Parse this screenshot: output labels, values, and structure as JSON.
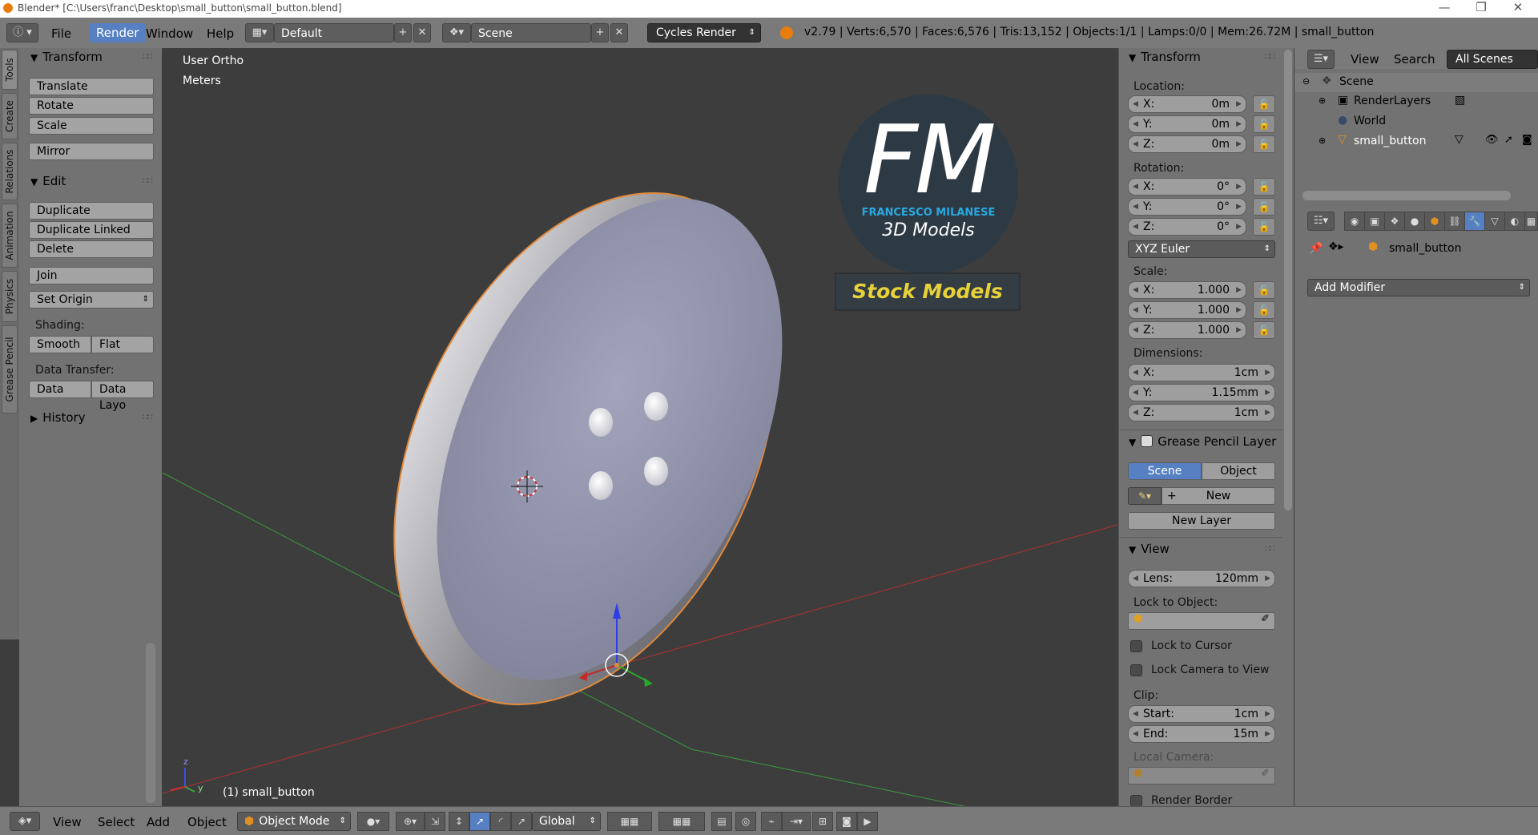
{
  "window": {
    "title": "Blender* [C:\\Users\\franc\\Desktop\\small_button\\small_button.blend]",
    "minimize": "—",
    "restore": "❐",
    "close": "✕"
  },
  "topbar": {
    "menus": [
      "File",
      "Render",
      "Window",
      "Help"
    ],
    "layout": "Default",
    "scene": "Scene",
    "engine": "Cycles Render",
    "stats": "v2.79 | Verts:6,570 | Faces:6,576 | Tris:13,152 | Objects:1/1 | Lamps:0/0 | Mem:26.72M | small_button"
  },
  "tabs": [
    "Tools",
    "Create",
    "Relations",
    "Animation",
    "Physics",
    "Grease Pencil"
  ],
  "tools": {
    "transform_title": "Transform",
    "translate": "Translate",
    "rotate": "Rotate",
    "scale": "Scale",
    "mirror": "Mirror",
    "edit_title": "Edit",
    "duplicate": "Duplicate",
    "duplicate_linked": "Duplicate Linked",
    "delete": "Delete",
    "join": "Join",
    "set_origin": "Set Origin",
    "shading_label": "Shading:",
    "smooth": "Smooth",
    "flat": "Flat",
    "data_transfer_label": "Data Transfer:",
    "data": "Data",
    "data_layout": "Data Layo",
    "history_title": "History"
  },
  "viewport": {
    "view_name": "User Ortho",
    "units": "Meters",
    "object_label": "(1) small_button",
    "logo_letters": "FM",
    "logo_name": "FRANCESCO MILANESE",
    "logo_sub": "3D Models",
    "logo_banner": "Stock Models",
    "colors": {
      "button": "#a0a2b8",
      "selected_outline": "#e08a3c",
      "x_axis": "#b03030",
      "y_axis": "#3a9a3a",
      "logo_blue": "#2aa8e0",
      "banner_text": "#e8d23a"
    }
  },
  "npanel": {
    "transform_title": "Transform",
    "location_label": "Location:",
    "location": {
      "x": "0m",
      "y": "0m",
      "z": "0m"
    },
    "rotation_label": "Rotation:",
    "rotation": {
      "x": "0°",
      "y": "0°",
      "z": "0°"
    },
    "rotation_mode": "XYZ Euler",
    "scale_label": "Scale:",
    "scale": {
      "x": "1.000",
      "y": "1.000",
      "z": "1.000"
    },
    "dimensions_label": "Dimensions:",
    "dimensions": {
      "x": "1cm",
      "y": "1.15mm",
      "z": "1cm"
    },
    "axis_x": "X:",
    "axis_y": "Y:",
    "axis_z": "Z:",
    "gp_layer_title": "Grease Pencil Layer",
    "gp_scene": "Scene",
    "gp_object": "Object",
    "gp_new": "New",
    "gp_new_layer": "New Layer",
    "view_title": "View",
    "lens_label": "Lens:",
    "lens": "120mm",
    "lock_to_object": "Lock to Object:",
    "lock_to_cursor": "Lock to Cursor",
    "lock_camera": "Lock Camera to View",
    "clip_label": "Clip:",
    "clip_start_label": "Start:",
    "clip_start": "1cm",
    "clip_end_label": "End:",
    "clip_end": "15m",
    "local_camera": "Local Camera:",
    "render_border": "Render Border"
  },
  "outliner": {
    "view": "View",
    "search": "Search",
    "filter": "All Scenes",
    "items": [
      "Scene",
      "RenderLayers",
      "World",
      "small_button"
    ]
  },
  "properties": {
    "object_name": "small_button",
    "add_modifier": "Add Modifier"
  },
  "bottombar": {
    "menus": [
      "View",
      "Select",
      "Add",
      "Object"
    ],
    "mode": "Object Mode",
    "orientation": "Global"
  }
}
